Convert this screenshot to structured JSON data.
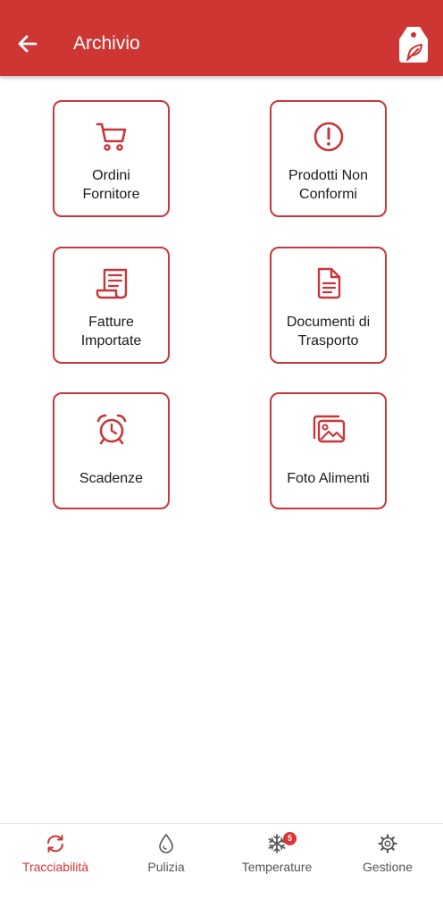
{
  "header": {
    "title": "Archivio",
    "background_color": "#CD3633",
    "back_icon": "arrow-left-icon",
    "action_icon": "price-tag-leaf-icon"
  },
  "tiles": [
    {
      "label": "Ordini\nFornitore",
      "icon": "shopping-cart-icon"
    },
    {
      "label": "Prodotti Non\nConformi",
      "icon": "exclamation-circle-icon"
    },
    {
      "label": "Fatture\nImportate",
      "icon": "receipt-icon"
    },
    {
      "label": "Documenti di\nTrasporto",
      "icon": "document-icon"
    },
    {
      "label": "Scadenze",
      "icon": "alarm-clock-icon"
    },
    {
      "label": "Foto Alimenti",
      "icon": "images-icon"
    }
  ],
  "accent_color": "#C7373A",
  "tabbar": {
    "items": [
      {
        "label": "Tracciabilità",
        "icon": "sync-icon",
        "active": true
      },
      {
        "label": "Pulizia",
        "icon": "water-drop-icon",
        "active": false
      },
      {
        "label": "Temperature",
        "icon": "snowflake-icon",
        "active": false,
        "badge": "5"
      },
      {
        "label": "Gestione",
        "icon": "cog-icon",
        "active": false
      }
    ],
    "active_color": "#CD3633",
    "inactive_color": "#555555"
  }
}
